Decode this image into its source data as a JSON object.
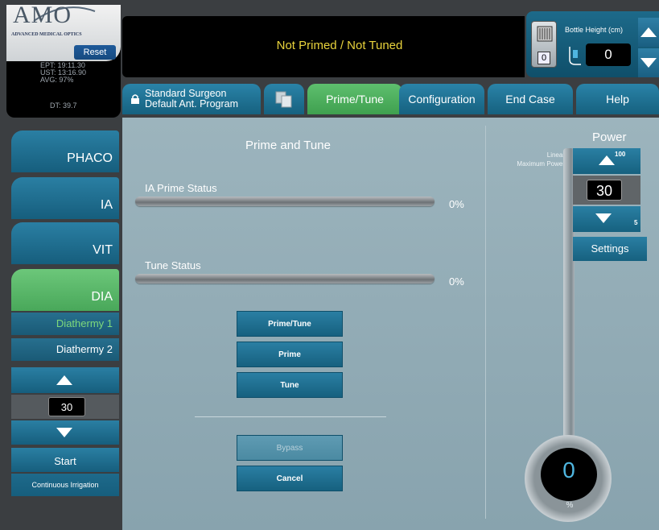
{
  "logo": {
    "brand": "AMO",
    "subtitle": "ADVANCED MEDICAL OPTICS"
  },
  "stats": {
    "reset_label": "Reset",
    "ept": "EPT: 19:11.30",
    "ust": "UST: 13:16.90",
    "avg": "AVG: 97%",
    "dt": "DT: 39.7"
  },
  "status": {
    "text": "Not Primed / Not Tuned"
  },
  "bottle": {
    "label": "Bottle Height (cm)",
    "level": "0",
    "value": "0"
  },
  "tabs": {
    "program_line1": "Standard Surgeon",
    "program_line2": "Default Ant. Program",
    "prime_tune": "Prime/Tune",
    "configuration": "Configuration",
    "end_case": "End Case",
    "help": "Help"
  },
  "nav": {
    "phaco": "PHACO",
    "ia": "IA",
    "vit": "VIT",
    "dia": "DIA",
    "diathermy1": "Diathermy 1",
    "diathermy2": "Diathermy 2",
    "value": "30",
    "start": "Start",
    "continuous": "Continuous Irrigation"
  },
  "prime_panel": {
    "title": "Prime and Tune",
    "ia_label": "IA Prime Status",
    "ia_progress": 0,
    "ia_percent": "0%",
    "tune_label": "Tune Status",
    "tune_progress": 0,
    "tune_percent": "0%",
    "buttons": {
      "prime_tune": "Prime/Tune",
      "prime": "Prime",
      "tune": "Tune",
      "bypass": "Bypass",
      "cancel": "Cancel"
    }
  },
  "power": {
    "title": "Power",
    "mode_line1": "Linear",
    "mode_line2": "Maximum Power",
    "max": "100",
    "value": "30",
    "min": "5",
    "settings": "Settings",
    "gauge_value": "0",
    "gauge_unit": "%"
  },
  "colors": {
    "accent_blue": "#1f7198",
    "active_green": "#4fae5f",
    "status_yellow": "#e9d33c",
    "gauge_blue": "#4fb6e0"
  }
}
